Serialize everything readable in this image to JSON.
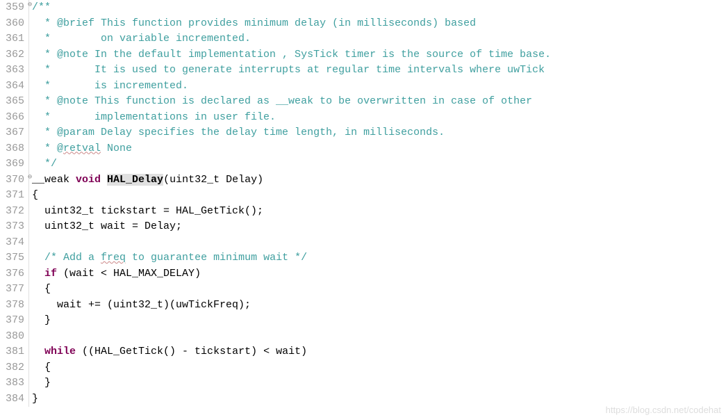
{
  "lines": [
    {
      "num": "359",
      "fold": true,
      "tokens": [
        {
          "class": "comment",
          "text": "/**"
        }
      ]
    },
    {
      "num": "360",
      "tokens": [
        {
          "class": "comment",
          "text": "  * @brief This function provides minimum delay (in milliseconds) based"
        }
      ]
    },
    {
      "num": "361",
      "tokens": [
        {
          "class": "comment",
          "text": "  *        on variable incremented."
        }
      ]
    },
    {
      "num": "362",
      "tokens": [
        {
          "class": "comment",
          "text": "  * @note In the default implementation , SysTick timer is the source of time base."
        }
      ]
    },
    {
      "num": "363",
      "tokens": [
        {
          "class": "comment",
          "text": "  *       It is used to generate interrupts at regular time intervals where uwTick"
        }
      ]
    },
    {
      "num": "364",
      "tokens": [
        {
          "class": "comment",
          "text": "  *       is incremented."
        }
      ]
    },
    {
      "num": "365",
      "tokens": [
        {
          "class": "comment",
          "text": "  * @note This function is declared as __weak to be overwritten in case of other"
        }
      ]
    },
    {
      "num": "366",
      "tokens": [
        {
          "class": "comment",
          "text": "  *       implementations in user file."
        }
      ]
    },
    {
      "num": "367",
      "tokens": [
        {
          "class": "comment",
          "text": "  * @param Delay specifies the delay time length, in milliseconds."
        }
      ]
    },
    {
      "num": "368",
      "tokens": [
        {
          "class": "comment",
          "text": "  * @"
        },
        {
          "class": "comment wavy",
          "text": "retval"
        },
        {
          "class": "comment",
          "text": " None"
        }
      ]
    },
    {
      "num": "369",
      "tokens": [
        {
          "class": "comment",
          "text": "  */"
        }
      ]
    },
    {
      "num": "370",
      "fold": true,
      "tokens": [
        {
          "class": "type",
          "text": "__weak "
        },
        {
          "class": "keyword",
          "text": "void"
        },
        {
          "class": "punct",
          "text": " "
        },
        {
          "class": "fn-highlight",
          "text": "HAL_Delay"
        },
        {
          "class": "punct",
          "text": "(uint32_t Delay)"
        }
      ]
    },
    {
      "num": "371",
      "tokens": [
        {
          "class": "punct",
          "text": "{"
        }
      ]
    },
    {
      "num": "372",
      "tokens": [
        {
          "class": "punct",
          "text": "  uint32_t tickstart = HAL_GetTick();"
        }
      ]
    },
    {
      "num": "373",
      "tokens": [
        {
          "class": "punct",
          "text": "  uint32_t wait = Delay;"
        }
      ]
    },
    {
      "num": "374",
      "tokens": []
    },
    {
      "num": "375",
      "tokens": [
        {
          "class": "comment",
          "text": "  /* Add a "
        },
        {
          "class": "comment wavy",
          "text": "freq"
        },
        {
          "class": "comment",
          "text": " to guarantee minimum wait */"
        }
      ]
    },
    {
      "num": "376",
      "tokens": [
        {
          "class": "punct",
          "text": "  "
        },
        {
          "class": "keyword",
          "text": "if"
        },
        {
          "class": "punct",
          "text": " (wait < HAL_MAX_DELAY)"
        }
      ]
    },
    {
      "num": "377",
      "tokens": [
        {
          "class": "punct",
          "text": "  {"
        }
      ]
    },
    {
      "num": "378",
      "tokens": [
        {
          "class": "punct",
          "text": "    wait += (uint32_t)(uwTickFreq);"
        }
      ]
    },
    {
      "num": "379",
      "tokens": [
        {
          "class": "punct",
          "text": "  }"
        }
      ]
    },
    {
      "num": "380",
      "tokens": []
    },
    {
      "num": "381",
      "tokens": [
        {
          "class": "punct",
          "text": "  "
        },
        {
          "class": "keyword",
          "text": "while"
        },
        {
          "class": "punct",
          "text": " ((HAL_GetTick() - tickstart) < wait)"
        }
      ]
    },
    {
      "num": "382",
      "tokens": [
        {
          "class": "punct",
          "text": "  {"
        }
      ]
    },
    {
      "num": "383",
      "tokens": [
        {
          "class": "punct",
          "text": "  }"
        }
      ]
    },
    {
      "num": "384",
      "tokens": [
        {
          "class": "punct",
          "text": "}"
        }
      ]
    }
  ],
  "watermark": "https://blog.csdn.net/codehat"
}
